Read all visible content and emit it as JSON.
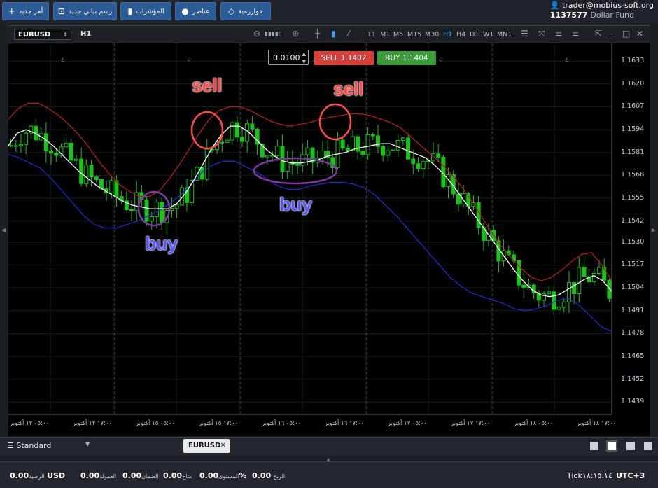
{
  "toolbar": {
    "new_order": "أمر جديد",
    "new_chart": "رسم بياني جديد",
    "indicators": "المؤشرات",
    "objects": "عناصر",
    "algorithms": "خوارزمية"
  },
  "account": {
    "user": "trader@mobius-soft.org",
    "balance": "1137577",
    "fund": "Dollar Fund"
  },
  "chart": {
    "symbol": "EURUSD",
    "timeframe": "H1",
    "timeframes": [
      "T1",
      "M1",
      "M5",
      "M15",
      "M30",
      "H1",
      "H4",
      "D1",
      "W1",
      "MN1"
    ],
    "active_timeframe": "H1",
    "lot": "0.0100",
    "sell_label": "SELL 1.1402",
    "buy_label": "BUY 1.1404",
    "top_marks": [
      "ع",
      "ن",
      "ع",
      "ن",
      "ع",
      "ن",
      "ع"
    ]
  },
  "annotations": {
    "sell1": "sell",
    "sell2": "sell",
    "buy1": "buy",
    "buy2": "buy"
  },
  "chart_data": {
    "type": "candlestick",
    "y_ticks": [
      "1.1633",
      "1.1620",
      "1.1607",
      "1.1594",
      "1.1581",
      "1.1568",
      "1.1555",
      "1.1542",
      "1.1530",
      "1.1517",
      "1.1504",
      "1.1491",
      "1.1478",
      "1.1465",
      "1.1452",
      "1.1439"
    ],
    "ylim": [
      1.1432,
      1.1643
    ],
    "x_ticks": [
      "٠٥:٠٠ ١٢ أكتوبر",
      "١٧:٠٠ ١٢ أكتوبر",
      "٠٥:٠٠ ١٥ أكتوبر",
      "١٧:٠٠ ١٥ أكتوبر",
      "٠٥:٠٠ ١٦ أكتوبر",
      "١٧:٠٠ ١٦ أكتوبر",
      "٠٥:٠٠ ١٧ أكتوبر",
      "١٧:٠٠ ١٧ أكتوبر",
      "٠٥:٠٠ ١٨ أكتوبر",
      "١٧:٠٠ ١٨ أكتوبر"
    ],
    "colors": {
      "candle": "#19c419",
      "middle": "#ffffff",
      "upper": "#b31c1c",
      "lower": "#2228c8"
    },
    "middle_line": [
      1.1585,
      1.1592,
      1.1594,
      1.1592,
      1.1589,
      1.1585,
      1.158,
      1.1575,
      1.157,
      1.1566,
      1.1562,
      1.1559,
      1.1556,
      1.1553,
      1.1551,
      1.155,
      1.1549,
      1.1549,
      1.1549,
      1.1552,
      1.1558,
      1.1566,
      1.1575,
      1.1584,
      1.1591,
      1.1596,
      1.1596,
      1.1593,
      1.1588,
      1.1583,
      1.1579,
      1.1576,
      1.1575,
      1.1575,
      1.1576,
      1.1577,
      1.1579,
      1.158,
      1.1581,
      1.1583,
      1.1584,
      1.1585,
      1.1586,
      1.1586,
      1.1584,
      1.1582,
      1.158,
      1.1578,
      1.1574,
      1.1569,
      1.1563,
      1.1556,
      1.1549,
      1.1542,
      1.1535,
      1.1528,
      1.1521,
      1.1514,
      1.1508,
      1.1503,
      1.15,
      1.1499,
      1.15,
      1.1503,
      1.1506,
      1.1509,
      1.1511,
      1.1508,
      1.1502
    ],
    "upper_line": [
      1.16,
      1.1606,
      1.1609,
      1.1609,
      1.1606,
      1.1602,
      1.1597,
      1.1591,
      1.1584,
      1.1576,
      1.1569,
      1.1563,
      1.1559,
      1.1556,
      1.1556,
      1.1559,
      1.1566,
      1.1574,
      1.1583,
      1.1592,
      1.16,
      1.1605,
      1.1607,
      1.1607,
      1.1605,
      1.1602,
      1.1599,
      1.1597,
      1.1596,
      1.1597,
      1.1598,
      1.16,
      1.1601,
      1.1602,
      1.1603,
      1.1603,
      1.1602,
      1.16,
      1.1598,
      1.1595,
      1.159,
      1.1585,
      1.158,
      1.1575,
      1.1569,
      1.1562,
      1.1554,
      1.1545,
      1.1536,
      1.1528,
      1.1521,
      1.1515,
      1.151,
      1.1508,
      1.151,
      1.1514,
      1.1519,
      1.1523,
      1.1524,
      1.1517,
      1.1508
    ],
    "lower_line": [
      1.158,
      1.1578,
      1.1575,
      1.1572,
      1.1566,
      1.1559,
      1.1552,
      1.1545,
      1.154,
      1.1538,
      1.1538,
      1.154,
      1.1542,
      1.1545,
      1.1548,
      1.1552,
      1.1557,
      1.1563,
      1.157,
      1.1574,
      1.1576,
      1.1576,
      1.1573,
      1.157,
      1.1566,
      1.1562,
      1.156,
      1.156,
      1.1562,
      1.1563,
      1.1564,
      1.1564,
      1.1563,
      1.1561,
      1.1557,
      1.1551,
      1.1545,
      1.1538,
      1.1531,
      1.1524,
      1.1517,
      1.151,
      1.1505,
      1.1501,
      1.1499,
      1.1497,
      1.1495,
      1.1492,
      1.1491,
      1.1492,
      1.1494,
      1.1497,
      1.1498,
      1.1494,
      1.1488,
      1.1482,
      1.1479
    ]
  },
  "bottom": {
    "layout_select": "Standard",
    "tab_symbol": "EURUSD"
  },
  "status": {
    "balance_label": "الرصيد",
    "balance_value": "0.00",
    "currency": "USD",
    "commission_label": "العمولة",
    "commission_value": "0.00",
    "margin_label": "الضمان",
    "margin_value": "0.00",
    "available_label": "متاح",
    "available_value": "0.00",
    "level_label": "المستوى",
    "level_value": "%",
    "profit_label": "الربح",
    "profit_value": "0.00",
    "tick_label": "Tick",
    "clock": "١٨:١٥:١٤",
    "tz": "UTC+3"
  }
}
